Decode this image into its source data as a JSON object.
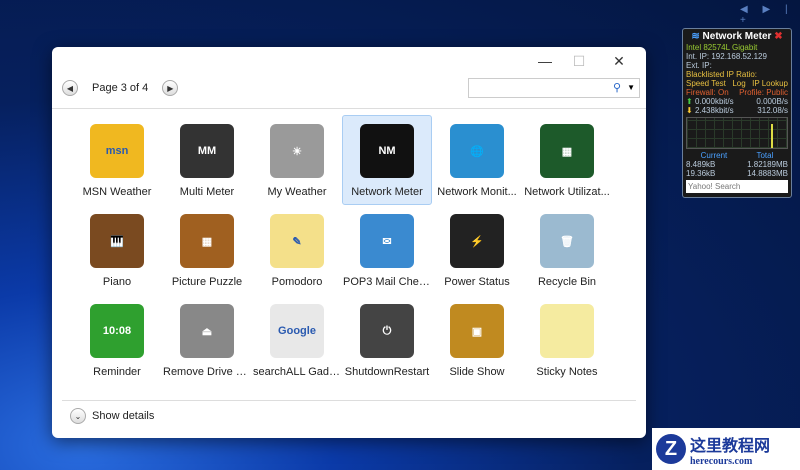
{
  "window": {
    "page_label": "Page 3 of 4",
    "search_placeholder": "",
    "show_details": "Show details"
  },
  "gadgets": [
    {
      "label": "MSN Weather",
      "color": "#f0b820",
      "glyph": "msn"
    },
    {
      "label": "Multi Meter",
      "color": "#333333",
      "glyph": "MM"
    },
    {
      "label": "My Weather",
      "color": "#9a9a9a",
      "glyph": "☀"
    },
    {
      "label": "Network Meter",
      "color": "#111111",
      "glyph": "NM",
      "selected": true
    },
    {
      "label": "Network Monit...",
      "color": "#2a8fd0",
      "glyph": "🌐"
    },
    {
      "label": "Network Utilizat...",
      "color": "#1d5a2a",
      "glyph": "▦"
    },
    {
      "label": "Piano",
      "color": "#7a4a20",
      "glyph": "🎹"
    },
    {
      "label": "Picture Puzzle",
      "color": "#a06020",
      "glyph": "▦"
    },
    {
      "label": "Pomodoro",
      "color": "#f4e08a",
      "glyph": "✎"
    },
    {
      "label": "POP3 Mail Chec...",
      "color": "#3a8ad0",
      "glyph": "✉"
    },
    {
      "label": "Power Status",
      "color": "#222222",
      "glyph": "⚡"
    },
    {
      "label": "Recycle Bin",
      "color": "#9bbad0",
      "glyph": "🗑"
    },
    {
      "label": "Reminder",
      "color": "#2fa02f",
      "glyph": "10:08"
    },
    {
      "label": "Remove Drive S...",
      "color": "#888888",
      "glyph": "⏏"
    },
    {
      "label": "searchALL Gadg...",
      "color": "#e8e8e8",
      "glyph": "Google"
    },
    {
      "label": "ShutdownRestart",
      "color": "#444444",
      "glyph": "⏻"
    },
    {
      "label": "Slide Show",
      "color": "#c08a20",
      "glyph": "▣"
    },
    {
      "label": "Sticky Notes",
      "color": "#f5eba0",
      "glyph": ""
    }
  ],
  "network_meter": {
    "title": "Network Meter",
    "adapter": "Intel 82574L Gigabit",
    "int_ip": "Int. IP: 192.168.52.129",
    "ext_ip": "Ext. IP:",
    "blacklisted": "Blacklisted IP Ratio:",
    "speed_test": "Speed Test",
    "log": "Log",
    "ip_lookup": "IP Lookup",
    "firewall": "Firewall: On",
    "profile": "Profile: Public",
    "up_bits": "0.000kbit/s",
    "up_bytes": "0.000B/s",
    "down_bits": "2.438kbit/s",
    "down_bytes": "312.08/s",
    "current": "Current",
    "total": "Total",
    "cur_up": "8.489kB",
    "cur_down": "19.36kB",
    "tot_up": "1.82189MB",
    "tot_down": "14.8883MB",
    "search": "Yahoo! Search"
  },
  "watermark": {
    "cn": "这里教程网",
    "url": "herecours.com"
  }
}
